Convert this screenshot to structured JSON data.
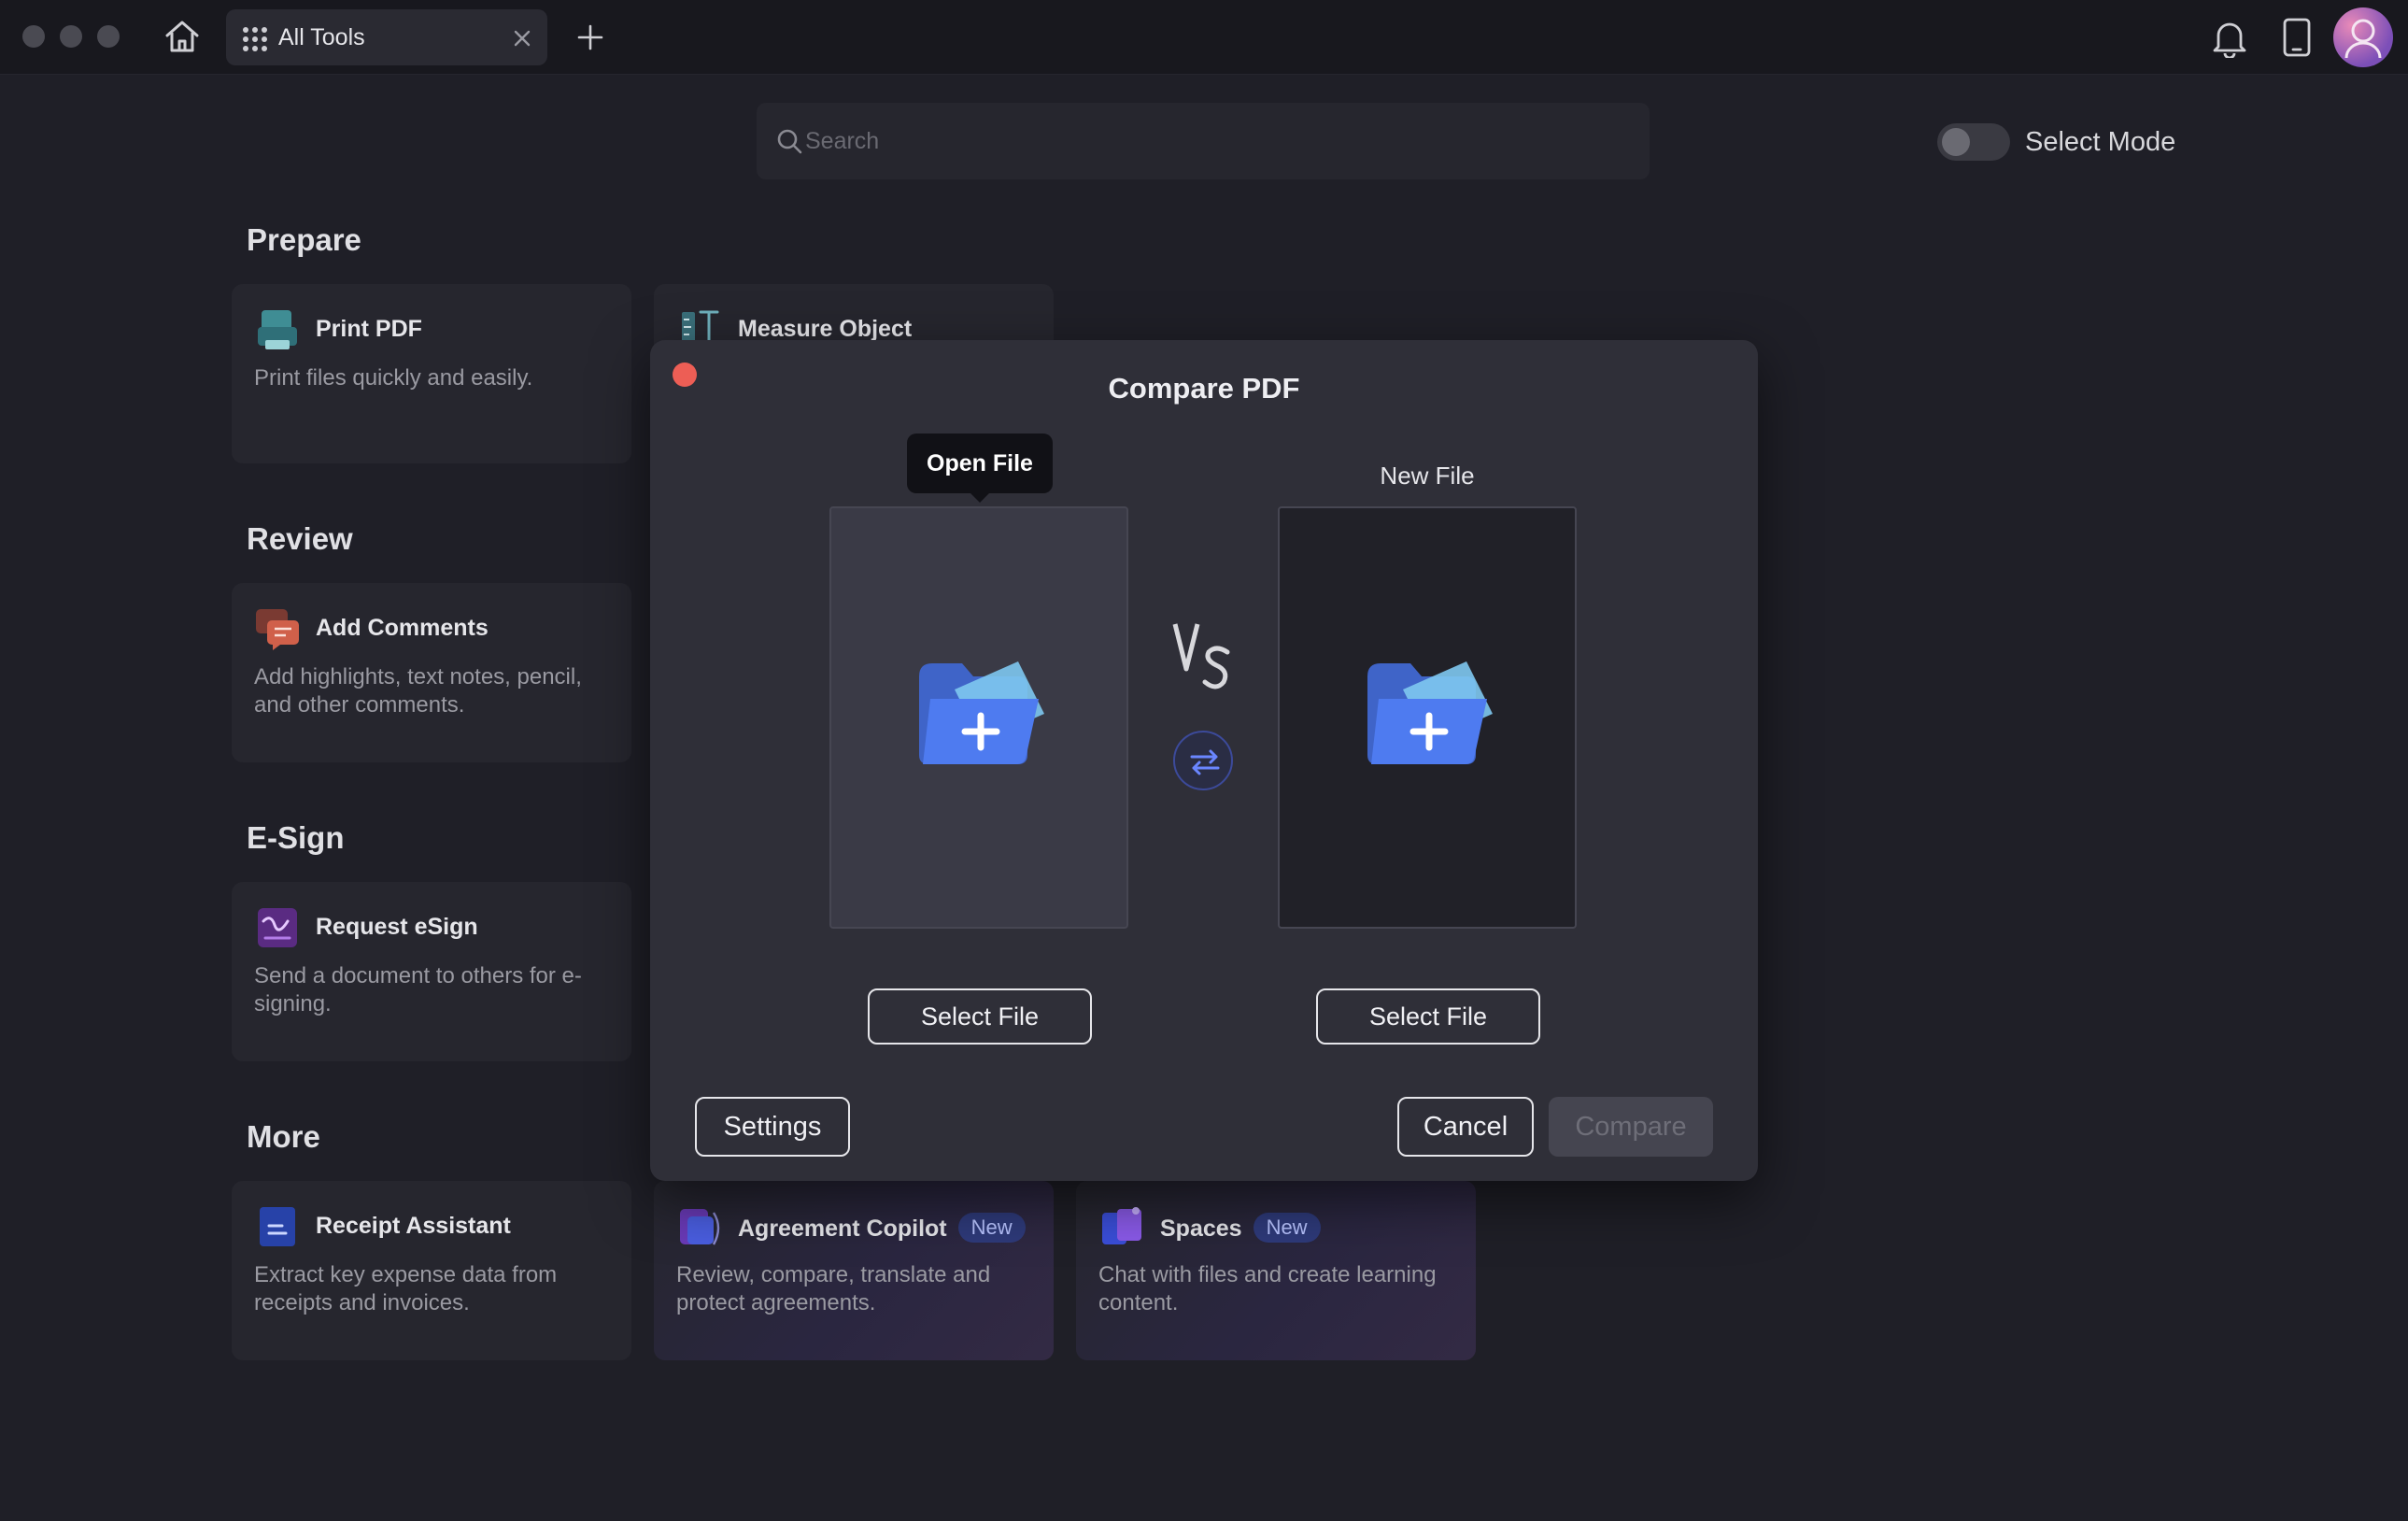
{
  "titlebar": {
    "tab_label": "All Tools",
    "icons": [
      "home-icon",
      "grid-icon",
      "close-icon",
      "plus-icon",
      "bell-icon",
      "device-icon",
      "avatar"
    ]
  },
  "search": {
    "placeholder": "Search",
    "value": ""
  },
  "select_mode": {
    "label": "Select Mode",
    "on": false
  },
  "sections": {
    "prepare": {
      "title": "Prepare",
      "cards": [
        {
          "title": "Print PDF",
          "desc": "Print files quickly and easily.",
          "icon": "printer-icon"
        },
        {
          "title": "Measure Object",
          "desc": "",
          "icon": "ruler-icon"
        }
      ]
    },
    "review": {
      "title": "Review",
      "cards": [
        {
          "title": "Add Comments",
          "desc": "Add highlights, text notes, pencil, and other comments.",
          "icon": "comment-icon"
        }
      ]
    },
    "esign": {
      "title": "E-Sign",
      "cards": [
        {
          "title": "Request eSign",
          "desc": "Send a document to others for e-signing.",
          "icon": "signature-icon"
        }
      ]
    },
    "more": {
      "title": "More",
      "cards": [
        {
          "title": "Receipt Assistant",
          "desc": "Extract key expense data from receipts and invoices.",
          "icon": "receipt-icon"
        },
        {
          "title": "Agreement Copilot",
          "badge": "New",
          "desc": "Review, compare, translate and protect agreements.",
          "icon": "agreement-icon"
        },
        {
          "title": "Spaces",
          "badge": "New",
          "desc": "Chat with files and create learning content.",
          "icon": "spaces-icon"
        }
      ]
    }
  },
  "dialog": {
    "title": "Compare PDF",
    "tooltip": "Open File",
    "new_file_label": "New File",
    "select_file_label": "Select File",
    "settings_label": "Settings",
    "cancel_label": "Cancel",
    "compare_label": "Compare",
    "vs_text": "VS"
  },
  "colors": {
    "background": "#1f1f27",
    "card": "#26262e",
    "dialog": "#2f2f38",
    "close_red": "#ed5e55",
    "folder_blue": "#4e7bf0",
    "badge_bg": "#2e3a7a"
  }
}
